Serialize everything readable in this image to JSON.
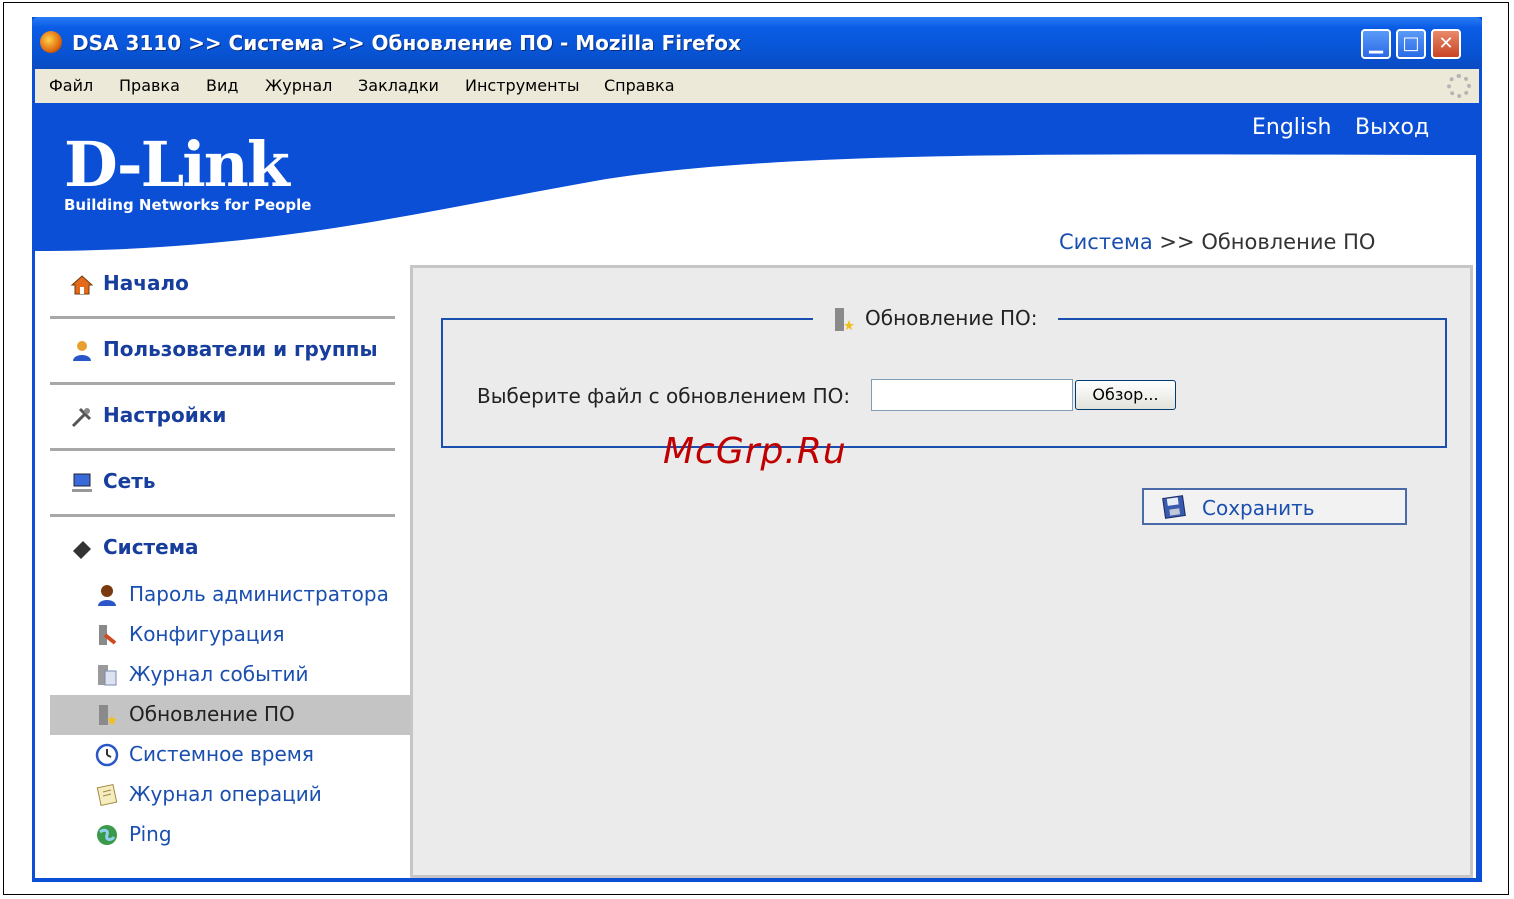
{
  "window": {
    "title": "DSA 3110 >> Система >> Обновление ПО - Mozilla Firefox",
    "minimize": "▁",
    "maximize": "□",
    "close": "✕"
  },
  "menubar": {
    "items": [
      "Файл",
      "Правка",
      "Вид",
      "Журнал",
      "Закладки",
      "Инструменты",
      "Справка"
    ]
  },
  "header": {
    "logo": "D-Link",
    "tagline": "Building Networks for People",
    "links": {
      "language": "English",
      "logout": "Выход"
    },
    "breadcrumb": {
      "parent": "Система",
      "separator": ">>",
      "current": "Обновление ПО"
    }
  },
  "sidebar": {
    "main_items": [
      {
        "label": "Начало",
        "icon": "home-icon"
      },
      {
        "label": "Пользователи и группы",
        "icon": "users-icon"
      },
      {
        "label": "Настройки",
        "icon": "tools-icon"
      },
      {
        "label": "Сеть",
        "icon": "network-icon"
      },
      {
        "label": "Система",
        "icon": "system-icon"
      }
    ],
    "sub_items": [
      {
        "label": "Пароль администратора",
        "icon": "admin-user-icon"
      },
      {
        "label": "Конфигурация",
        "icon": "config-icon"
      },
      {
        "label": "Журнал событий",
        "icon": "event-log-icon"
      },
      {
        "label": "Обновление ПО",
        "icon": "firmware-update-icon",
        "active": true
      },
      {
        "label": "Системное время",
        "icon": "clock-icon"
      },
      {
        "label": "Журнал операций",
        "icon": "operations-log-icon"
      },
      {
        "label": "Ping",
        "icon": "ping-icon"
      }
    ]
  },
  "main": {
    "section_title": "Обновление ПО:",
    "file_label": "Выберите файл с обновлением ПО:",
    "file_value": "",
    "browse_label": "Обзор...",
    "save_label": "Сохранить"
  },
  "watermark": "McGrp.Ru",
  "colors": {
    "brand_blue": "#0a4fd6",
    "link_blue": "#1a4fb0",
    "panel_bg": "#ebebeb",
    "active_item_bg": "#c4c4c4",
    "watermark_red": "#c00000"
  }
}
